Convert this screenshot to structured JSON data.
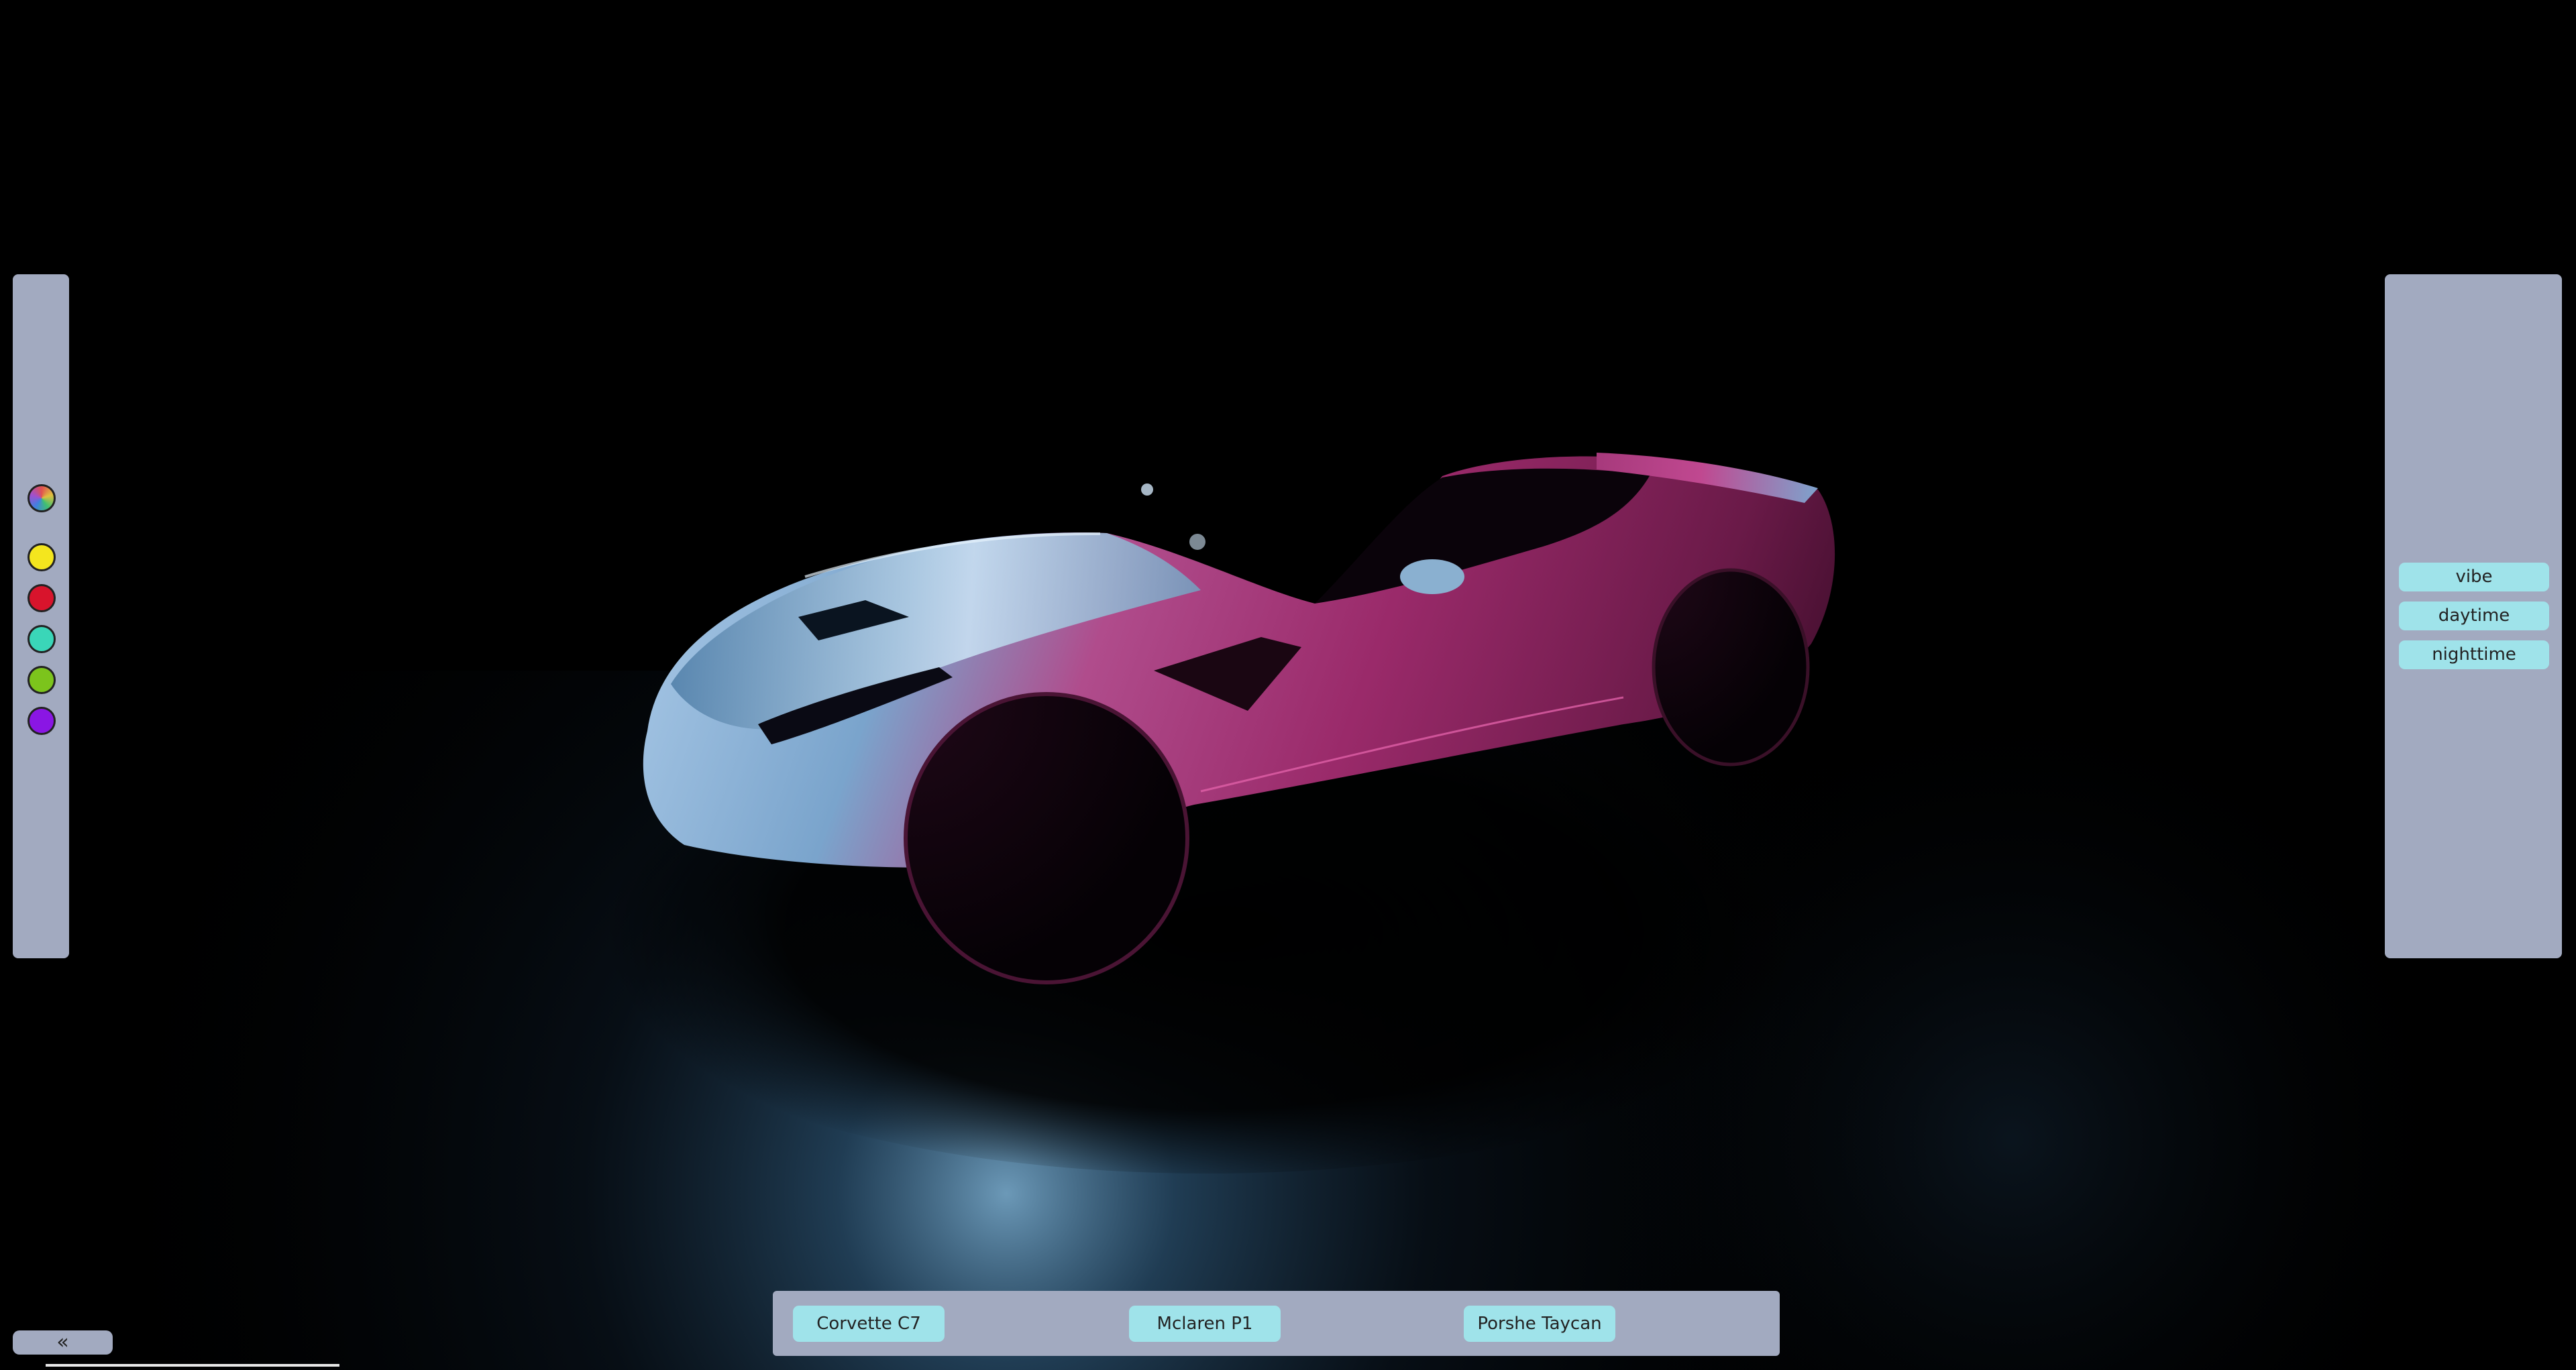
{
  "scene": {
    "car_color_hex": "#c02870",
    "highlight_hex": "#6aa8d8"
  },
  "color_panel": {
    "swatches": [
      {
        "name": "multicolor",
        "icon": "color-wheel-icon",
        "color": "conic"
      },
      {
        "name": "yellow",
        "icon": "color-swatch",
        "color": "#f4e61e"
      },
      {
        "name": "red",
        "icon": "color-swatch",
        "color": "#d8142c"
      },
      {
        "name": "teal",
        "icon": "color-swatch",
        "color": "#3ad6b8"
      },
      {
        "name": "green",
        "icon": "color-swatch",
        "color": "#7cc41c"
      },
      {
        "name": "purple",
        "icon": "color-swatch",
        "color": "#8a16e4"
      }
    ]
  },
  "env_panel": {
    "buttons": [
      {
        "label": "vibe"
      },
      {
        "label": "daytime"
      },
      {
        "label": "nighttime"
      }
    ]
  },
  "model_bar": {
    "models": [
      {
        "label": "Corvette C7"
      },
      {
        "label": "Mclaren P1"
      },
      {
        "label": "Porshe Taycan"
      }
    ]
  },
  "collapse": {
    "label": "«",
    "icon": "double-chevron-left-icon"
  }
}
